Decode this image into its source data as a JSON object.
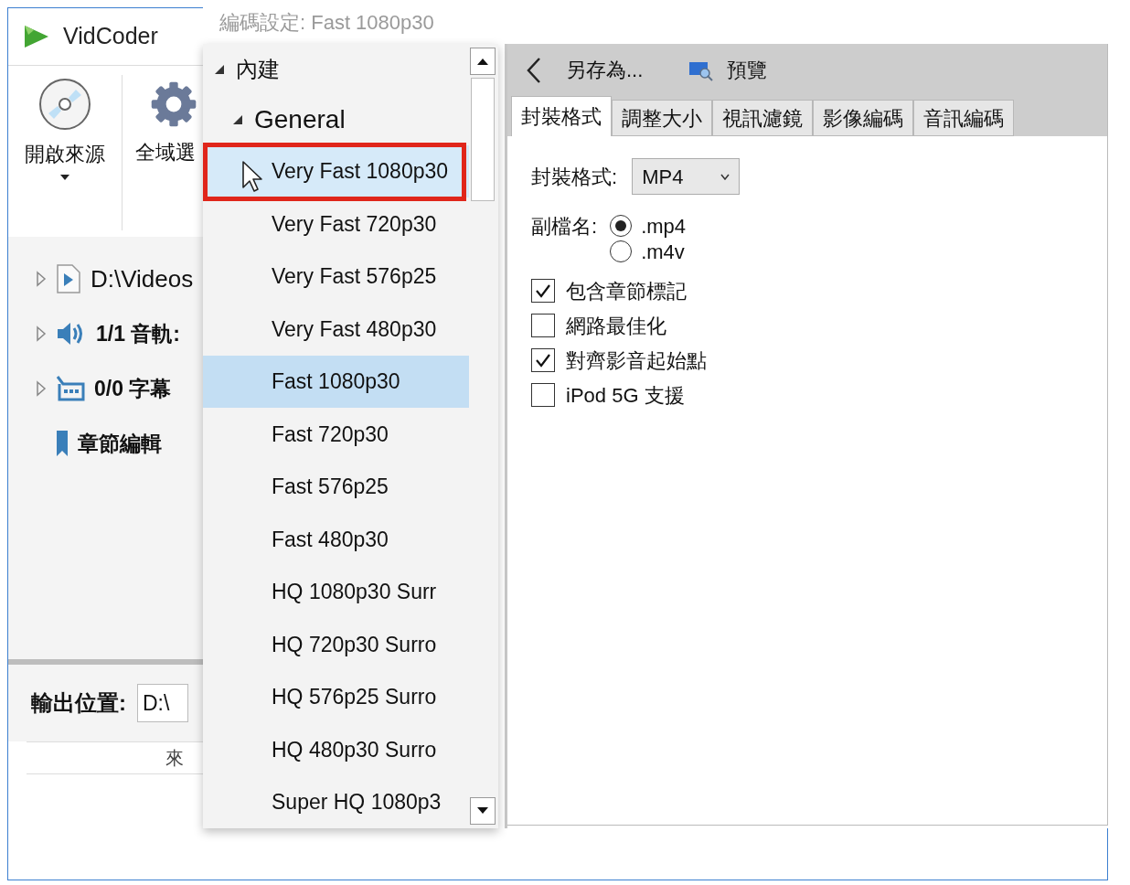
{
  "main_window": {
    "title": "VidCoder",
    "toolbar": [
      {
        "kind": "disc",
        "label": "開啟來源",
        "has_menu": true
      },
      {
        "kind": "gear",
        "label": "全域選",
        "has_menu": false
      }
    ],
    "source_tree": [
      {
        "kind": "video",
        "label": "D:\\Videos",
        "expandable": true
      },
      {
        "kind": "audio",
        "label": "1/1 音軌:",
        "expandable": true
      },
      {
        "kind": "subtitles",
        "label": "0/0 字幕",
        "expandable": true
      },
      {
        "kind": "chapters",
        "label": "章節編輯",
        "expandable": false
      }
    ],
    "output": {
      "label": "輸出位置:",
      "value": "D:\\"
    },
    "queue": {
      "columns": [
        "來"
      ]
    }
  },
  "encoding_window": {
    "title": "編碼設定: Fast 1080p30",
    "presets": [
      {
        "label": "內建",
        "expanded": true,
        "children": [
          {
            "label": "General",
            "expanded": true,
            "children": [
              {
                "label": "Very Fast 1080p30",
                "selected": false,
                "hovered": true,
                "annotated": true
              },
              {
                "label": "Very Fast 720p30",
                "selected": false,
                "hovered": false,
                "annotated": false
              },
              {
                "label": "Very Fast 576p25",
                "selected": false,
                "hovered": false,
                "annotated": false
              },
              {
                "label": "Very Fast 480p30",
                "selected": false,
                "hovered": false,
                "annotated": false
              },
              {
                "label": "Fast 1080p30",
                "selected": true,
                "hovered": false,
                "annotated": false
              },
              {
                "label": "Fast 720p30",
                "selected": false,
                "hovered": false,
                "annotated": false
              },
              {
                "label": "Fast 576p25",
                "selected": false,
                "hovered": false,
                "annotated": false
              },
              {
                "label": "Fast 480p30",
                "selected": false,
                "hovered": false,
                "annotated": false
              },
              {
                "label": "HQ 1080p30 Surr",
                "selected": false,
                "hovered": false,
                "annotated": false
              },
              {
                "label": "HQ 720p30 Surro",
                "selected": false,
                "hovered": false,
                "annotated": false
              },
              {
                "label": "HQ 576p25 Surro",
                "selected": false,
                "hovered": false,
                "annotated": false
              },
              {
                "label": "HQ 480p30 Surro",
                "selected": false,
                "hovered": false,
                "annotated": false
              },
              {
                "label": "Super HQ 1080p3",
                "selected": false,
                "hovered": false,
                "annotated": false
              }
            ]
          }
        ]
      }
    ],
    "toolbar": [
      {
        "kind": "back"
      },
      {
        "kind": "save",
        "label": "另存為..."
      },
      {
        "kind": "preview",
        "label": "預覽"
      }
    ],
    "tabs": [
      {
        "label": "封裝格式",
        "selected": true
      },
      {
        "label": "調整大小",
        "selected": false
      },
      {
        "label": "視訊濾鏡",
        "selected": false
      },
      {
        "label": "影像編碼",
        "selected": false
      },
      {
        "label": "音訊編碼",
        "selected": false
      }
    ],
    "container": {
      "label": "封裝格式:",
      "value": "MP4"
    },
    "extension": {
      "label": "副檔名:",
      "options": [
        {
          "label": ".mp4",
          "selected": true
        },
        {
          "label": ".m4v",
          "selected": false
        }
      ]
    },
    "options": [
      {
        "label": "包含章節標記",
        "checked": true
      },
      {
        "label": "網路最佳化",
        "checked": false
      },
      {
        "label": "對齊影音起始點",
        "checked": true
      },
      {
        "label": "iPod 5G 支援",
        "checked": false
      }
    ]
  }
}
